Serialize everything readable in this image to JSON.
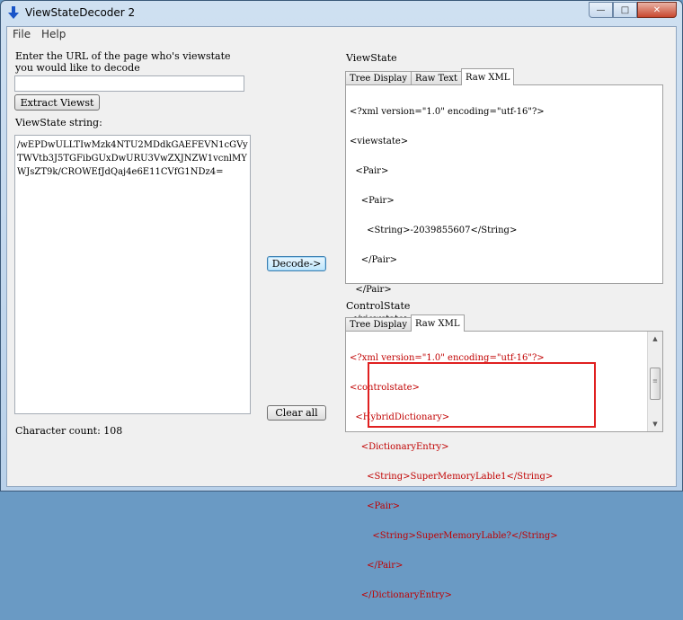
{
  "window": {
    "title": "ViewStateDecoder 2",
    "controls": {
      "minimize": "—",
      "maximize": "□",
      "close": "✕"
    }
  },
  "menu": {
    "items": [
      "File",
      "Help"
    ]
  },
  "left": {
    "url_prompt": "Enter the URL of the page who's viewstate\nyou would like to decode",
    "url_value": "",
    "extract_button": "Extract Viewst",
    "viewstate_label": "ViewState string:",
    "viewstate_value": "/wEPDwULLTIwMzk4NTU2MDdkGAEFEVN1cGVyTWVtb3J5TGFibGUxDwURU3VwZXJNZW1vcnlMYWJsZT9k/CROWEfJdQaj4e6E11CVfG1NDz4=",
    "char_count": "Character count: 108"
  },
  "middle": {
    "decode_button": "Decode->",
    "clear_button": "Clear all"
  },
  "viewstate": {
    "section_label": "ViewState",
    "tabs": [
      "Tree Display",
      "Raw Text",
      "Raw XML"
    ],
    "active_tab": "Raw XML",
    "xml_lines": [
      "<?xml version=\"1.0\" encoding=\"utf-16\"?>",
      "<viewstate>",
      "  <Pair>",
      "    <Pair>",
      "      <String>-2039855607</String>",
      "    </Pair>",
      "  </Pair>",
      "</viewstate>"
    ]
  },
  "controlstate": {
    "section_label": "ControlState",
    "tabs": [
      "Tree Display",
      "Raw XML"
    ],
    "active_tab": "Raw XML",
    "xml_lines": [
      "<?xml version=\"1.0\" encoding=\"utf-16\"?>",
      "<controlstate>",
      "  <HybridDictionary>",
      "    <DictionaryEntry>",
      "      <String>SuperMemoryLable1</String>",
      "      <Pair>",
      "        <String>SuperMemoryLable?</String>",
      "      </Pair>",
      "    </DictionaryEntry>"
    ],
    "highlight_color": "#e02020",
    "xml_color": "#c00000"
  }
}
